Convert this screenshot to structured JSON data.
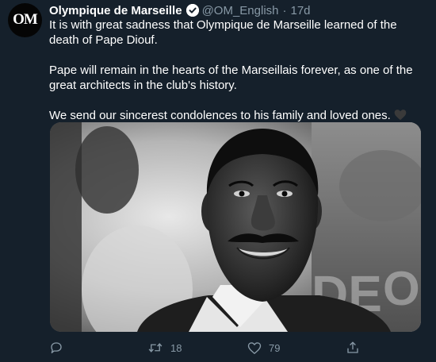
{
  "account": {
    "display_name": "Olympique de Marseille",
    "handle": "@OM_English",
    "separator": "·",
    "timestamp": "17d",
    "avatar_monogram": "OM",
    "verified": true
  },
  "tweet": {
    "paragraphs": [
      "It is with great sadness that Olympique de Marseille learned of the death of Pape Diouf.",
      "Pape will remain in the hearts of the Marseillais forever, as one of the great architects in the club's history.",
      "We send our sincerest condolences to his family and loved ones."
    ],
    "emoji": "black-heart",
    "media": {
      "type": "photo",
      "style": "black-and-white portrait"
    }
  },
  "actions": {
    "reply": {
      "icon": "reply-icon",
      "count": ""
    },
    "retweet": {
      "icon": "retweet-icon",
      "count": "18"
    },
    "like": {
      "icon": "heart-icon",
      "count": "79"
    },
    "share": {
      "icon": "share-icon",
      "count": ""
    }
  },
  "colors": {
    "background": "#15202b",
    "text": "#ffffff",
    "secondary": "#8899a6"
  }
}
